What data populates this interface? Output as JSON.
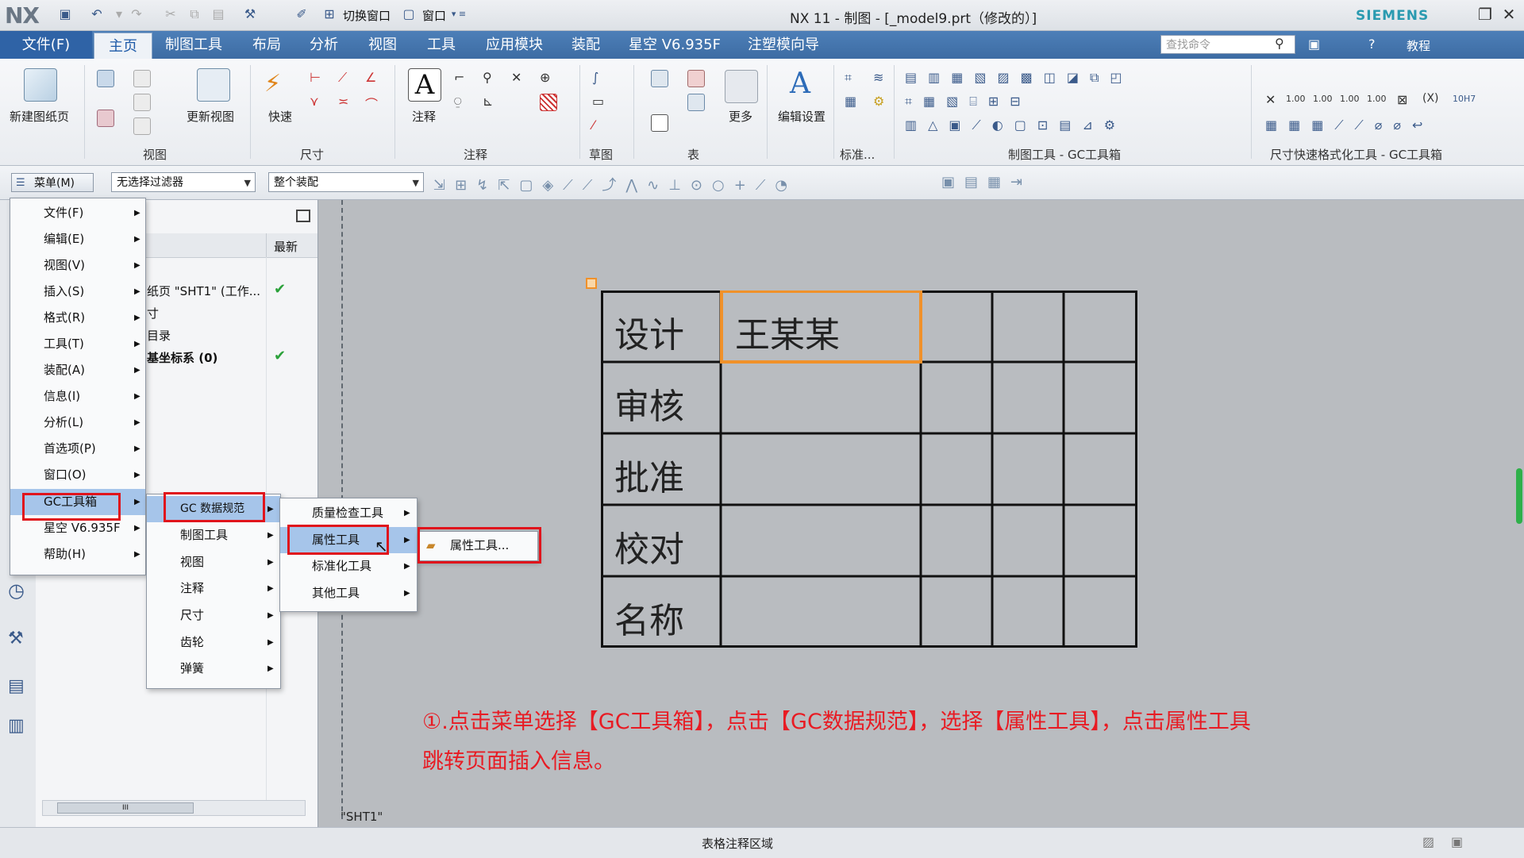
{
  "app": {
    "logo": "NX",
    "window_title": "NX 11 - 制图 - [_model9.prt（修改的）]",
    "brand": "SIEMENS",
    "quick_access": {
      "switch_window": "切换窗口",
      "window": "窗口"
    }
  },
  "tabs": {
    "file": "文件(F)",
    "items": [
      "主页",
      "制图工具",
      "布局",
      "分析",
      "视图",
      "工具",
      "应用模块",
      "装配",
      "星空 V6.935F",
      "注塑模向导"
    ],
    "active": "主页",
    "search_placeholder": "查找命令",
    "help_label": "教程"
  },
  "ribbon": {
    "new_sheet": "新建图纸页",
    "update_views": "更新视图",
    "quick": "快速",
    "note": "注释",
    "more": "更多",
    "edit_settings": "编辑设置",
    "groups": {
      "view": "视图",
      "dimension": "尺寸",
      "annotation": "注释",
      "sketch": "草图",
      "table": "表",
      "standard": "标准...",
      "gc_drafting": "制图工具 - GC工具箱",
      "gc_dim_format": "尺寸快速格式化工具 - GC工具箱"
    },
    "dim_samples": [
      "1.00",
      "1.00",
      "1.00",
      "1.00",
      "10H7"
    ]
  },
  "selection_bar": {
    "menu_button": "菜单(M)",
    "filter": "无选择过滤器",
    "scope": "整个装配"
  },
  "navigator": {
    "column_latest": "最新",
    "rows": [
      {
        "text": "纸页 \"SHT1\" (工作...",
        "check": true
      },
      {
        "text": "寸",
        "check": false
      },
      {
        "text": "目录",
        "check": false
      },
      {
        "text": "基坐标系 (0)",
        "check": true
      }
    ],
    "scroll_label": "III"
  },
  "main_menu": {
    "items": [
      "文件(F)",
      "编辑(E)",
      "视图(V)",
      "插入(S)",
      "格式(R)",
      "工具(T)",
      "装配(A)",
      "信息(I)",
      "分析(L)",
      "首选项(P)",
      "窗口(O)",
      "GC工具箱",
      "星空 V6.935F",
      "帮助(H)"
    ],
    "highlighted": "GC工具箱"
  },
  "gc_menu": {
    "items": [
      "GC 数据规范",
      "制图工具",
      "视图",
      "注释",
      "尺寸",
      "齿轮",
      "弹簧"
    ],
    "highlighted": "GC 数据规范"
  },
  "data_spec_menu": {
    "items": [
      "质量检查工具",
      "属性工具",
      "标准化工具",
      "其他工具"
    ],
    "highlighted": "属性工具"
  },
  "attr_menu": {
    "items": [
      "属性工具..."
    ]
  },
  "drawing": {
    "sheet_name": "\"SHT1\"",
    "title_block": [
      [
        "设计",
        "王某某",
        "",
        "",
        ""
      ],
      [
        "审核",
        "",
        "",
        "",
        ""
      ],
      [
        "批准",
        "",
        "",
        "",
        ""
      ],
      [
        "校对",
        "",
        "",
        "",
        ""
      ],
      [
        "名称",
        "",
        "",
        "",
        ""
      ]
    ]
  },
  "annotation": {
    "line1": "①.点击菜单选择【GC工具箱】，点击【GC数据规范】，选择【属性工具】，点击属性工具",
    "line2": "跳转页面插入信息。"
  },
  "status": {
    "text": "表格注释区域"
  }
}
